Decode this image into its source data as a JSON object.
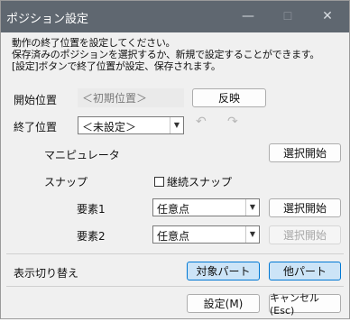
{
  "window": {
    "title": "ポジション設定",
    "minimize": "—",
    "maximize": "☐",
    "close": "✕"
  },
  "intro": [
    "動作の終了位置を設定してください。",
    "保存済みのポジションを選択するか、新規で設定することができます。",
    "[設定]ボタンで終了位置が設定、保存されます。"
  ],
  "start": {
    "label": "開始位置",
    "value": "＜初期位置＞",
    "apply_button": "反映"
  },
  "end": {
    "label": "終了位置",
    "value": "＜未設定＞",
    "undo_icon": "↶",
    "redo_icon": "↷"
  },
  "manipulator": {
    "label": "マニピュレータ",
    "button": "選択開始"
  },
  "snap": {
    "label": "スナップ",
    "continuous_label": "継続スナップ"
  },
  "elements": [
    {
      "label": "要素1",
      "value": "任意点",
      "button": "選択開始"
    },
    {
      "label": "要素2",
      "value": "任意点",
      "button": "選択開始"
    }
  ],
  "display_switch": {
    "label": "表示切り替え",
    "target_button": "対象パート",
    "other_button": "他パート"
  },
  "footer": {
    "ok_button": "設定(M)",
    "cancel_button": "キャンセル(Esc)"
  }
}
